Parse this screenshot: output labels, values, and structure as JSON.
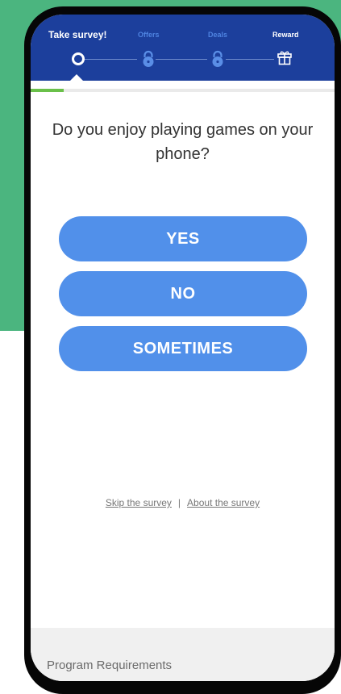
{
  "header": {
    "steps": [
      {
        "label": "Take survey!",
        "state": "active",
        "icon": "circle-icon"
      },
      {
        "label": "Offers",
        "state": "locked",
        "icon": "lock-icon"
      },
      {
        "label": "Deals",
        "state": "locked",
        "icon": "lock-icon"
      },
      {
        "label": "Reward",
        "state": "locked",
        "icon": "gift-icon"
      }
    ]
  },
  "progress": {
    "value_percent": 11
  },
  "survey": {
    "question": "Do you enjoy playing games on your phone?",
    "answers": [
      "YES",
      "NO",
      "SOMETIMES"
    ]
  },
  "links": {
    "skip": "Skip the survey",
    "separator": "|",
    "about": "About the survey"
  },
  "requirements": {
    "title": "Program Requirements"
  },
  "colors": {
    "page_background": "#4bb57f",
    "header_background": "#1c3f9c",
    "button": "#5190ea",
    "progress": "#6ac04a",
    "locked_step_label": "#4e83e0"
  }
}
